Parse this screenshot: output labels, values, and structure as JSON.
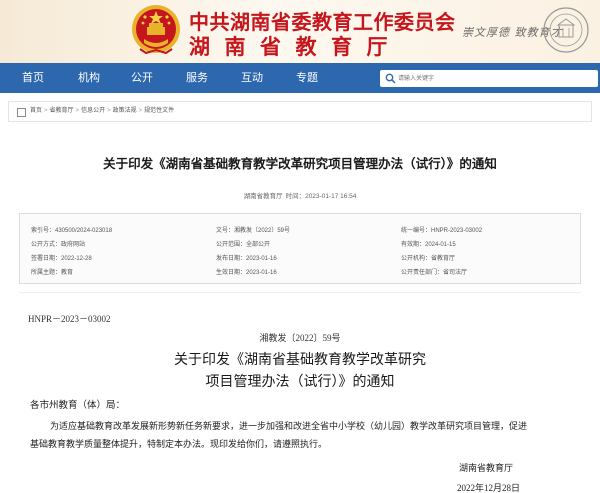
{
  "header": {
    "title_line1": "中共湖南省委教育工作委员会",
    "title_line2": "湖南省教育厅",
    "motto": "崇文厚德 致教育才"
  },
  "nav": {
    "items": [
      "首页",
      "机构",
      "公开",
      "服务",
      "互动",
      "专题"
    ]
  },
  "search": {
    "placeholder": "请输入关键字"
  },
  "breadcrumb": {
    "items": [
      "首页",
      "省教育厅",
      "信息公开",
      "政策法规",
      "规范性文件"
    ],
    "separator": ">"
  },
  "article": {
    "title": "关于印发《湖南省基础教育教学改革研究项目管理办法（试行）》的通知",
    "source": "湖南省教育厅",
    "time_label": "时间：",
    "time": "2023-01-17 16:54"
  },
  "info": {
    "index_no": "索引号：430500/2024-023018",
    "doc_no": "文号：湘教发〔2022〕59号",
    "uniform_no": "统一编号：HNPR-2023-03002",
    "open_method": "公开方式：政府网站",
    "open_scope": "公开范围：全部公开",
    "validity_date": "有效期：2024-01-15",
    "sign_date": "签署日期：2022-12-28",
    "publish_date": "发布日期：2023-01-16",
    "open_agency": "公开机构：省教育厅",
    "subject": "所属主题：教育",
    "effective_date": "生效日期：2023-01-16",
    "responsible_office": "公开责任部门：省司法厅"
  },
  "document": {
    "number": "HNPR－2023－03002",
    "ref": "湘教发〔2022〕59号",
    "title_line1": "关于印发《湖南省基础教育教学改革研究",
    "title_line2": "项目管理办法（试行）》的通知",
    "salutation": "各市州教育（体）局：",
    "body_line1": "为适应基础教育改革发展新形势新任务新要求，进一步加强和改进全省中小学校（幼儿园）教学改革研究项目管理，促进",
    "body_line2": "基础教育教学质量整体提升，特制定本办法。现印发给你们，请遵照执行。",
    "issuer": "湖南省教育厅",
    "issue_date": "2022年12月28日"
  },
  "colors": {
    "header_red": "#c4161c",
    "nav_blue": "#2d67ae",
    "emblem_gold": "#e8b32a"
  },
  "icons": [
    "national-emblem-icon",
    "university-seal-icon",
    "search-icon",
    "home-icon"
  ]
}
